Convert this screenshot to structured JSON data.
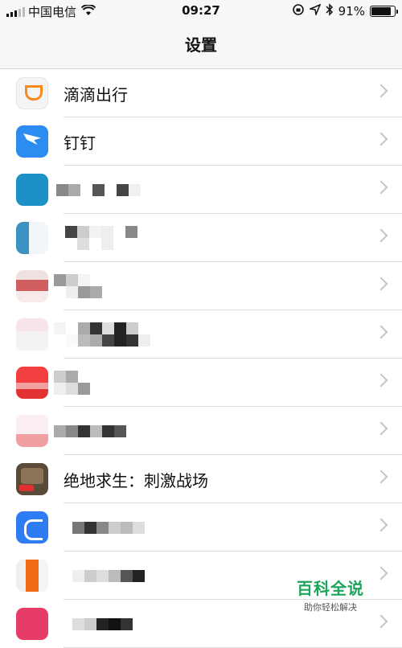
{
  "status_bar": {
    "carrier": "中国电信",
    "time": "09:27",
    "battery_text": "91%",
    "battery_level": 0.91
  },
  "nav": {
    "title": "设置"
  },
  "rows": [
    {
      "label": "滴滴出行",
      "icon": "didi-icon"
    },
    {
      "label": "钉钉",
      "icon": "dingtalk-icon"
    },
    {
      "label": "",
      "icon": "blurred-app-icon"
    },
    {
      "label": "",
      "icon": "blurred-app-icon"
    },
    {
      "label": "",
      "icon": "blurred-app-icon"
    },
    {
      "label": "",
      "icon": "blurred-app-icon"
    },
    {
      "label": "",
      "icon": "blurred-app-icon"
    },
    {
      "label": "",
      "icon": "blurred-app-icon"
    },
    {
      "label": "绝地求生：刺激战场",
      "icon": "pubg-icon"
    },
    {
      "label": "",
      "icon": "blurred-app-icon"
    },
    {
      "label": "",
      "icon": "blurred-app-icon"
    },
    {
      "label": "",
      "icon": "blurred-app-icon"
    }
  ],
  "watermark": {
    "brand": "百科全说",
    "sub": "助你轻松解决"
  }
}
